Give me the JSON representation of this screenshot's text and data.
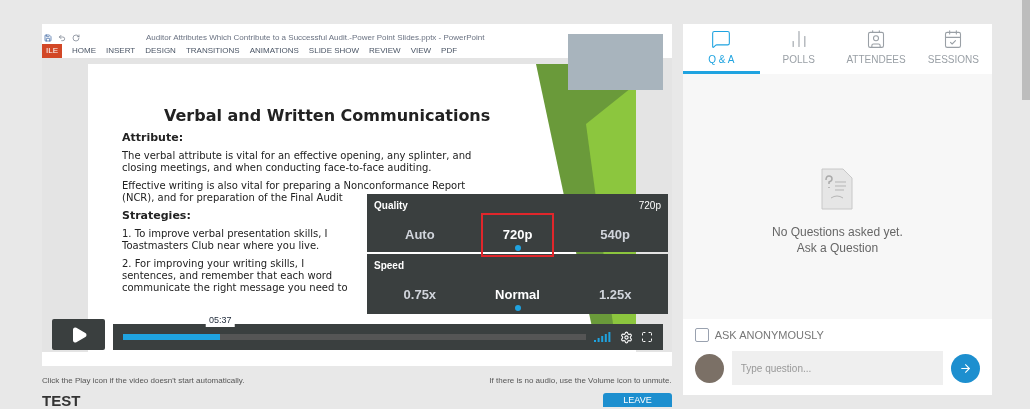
{
  "video": {
    "app_window": {
      "title": "Auditor Attributes Which Contribute to a Successful Audit.-Power Point Slides.pptx - PowerPoint",
      "file_tab": "ILE",
      "ribbon_tabs": [
        "HOME",
        "INSERT",
        "DESIGN",
        "TRANSITIONS",
        "ANIMATIONS",
        "SLIDE SHOW",
        "REVIEW",
        "VIEW",
        "PDF"
      ]
    },
    "slide": {
      "title": "Verbal and Written Communications",
      "blocks": [
        {
          "kind": "heading",
          "lines": [
            "Attribute:"
          ]
        },
        {
          "kind": "body",
          "lines": [
            "The verbal attribute is vital for an effective opening, any splinter, and",
            "closing meetings, and when conducting face-to-face auditing."
          ]
        },
        {
          "kind": "body",
          "lines": [
            "Effective writing is also vital for preparing a Nonconformance Report",
            "(NCR), and for preparation of the Final Audit"
          ]
        },
        {
          "kind": "heading",
          "lines": [
            "Strategies:"
          ]
        },
        {
          "kind": "body",
          "lines": [
            "1. To improve verbal presentation skills, I",
            "Toastmasters Club near where you live."
          ]
        },
        {
          "kind": "body",
          "lines": [
            "2. For improving your writing skills, I",
            "sentences, and remember that each word",
            "communicate the right message you need to"
          ]
        }
      ]
    },
    "settings": {
      "quality": {
        "label": "Quality",
        "current": "720p",
        "options": [
          {
            "label": "Auto",
            "selected": false,
            "highlighted": false
          },
          {
            "label": "720p",
            "selected": true,
            "highlighted": true
          },
          {
            "label": "540p",
            "selected": false,
            "highlighted": false
          }
        ]
      },
      "speed": {
        "label": "Speed",
        "options": [
          {
            "label": "0.75x",
            "selected": false,
            "highlighted": false
          },
          {
            "label": "Normal",
            "selected": true,
            "highlighted": false
          },
          {
            "label": "1.25x",
            "selected": false,
            "highlighted": false
          }
        ]
      }
    },
    "player": {
      "time": "05:37",
      "level": 0.21
    }
  },
  "hints": [
    "Click the Play icon if the video doesn't start automatically.",
    "If there is no audio, use the Volume icon to unmute."
  ],
  "section_title": "TEST",
  "leave_button": "LEAVE",
  "panel": {
    "tabs": [
      {
        "label": "Q & A",
        "selected": true
      },
      {
        "label": "POLLS",
        "selected": false
      },
      {
        "label": "ATTENDEES",
        "selected": false
      },
      {
        "label": "SESSIONS",
        "selected": false
      }
    ],
    "empty_state": [
      "No Questions asked yet.",
      "Ask a Question"
    ],
    "anonymous": {
      "label": "ASK ANONYMOUSLY",
      "checked": false
    },
    "question_input": {
      "placeholder": "Type question..."
    }
  }
}
